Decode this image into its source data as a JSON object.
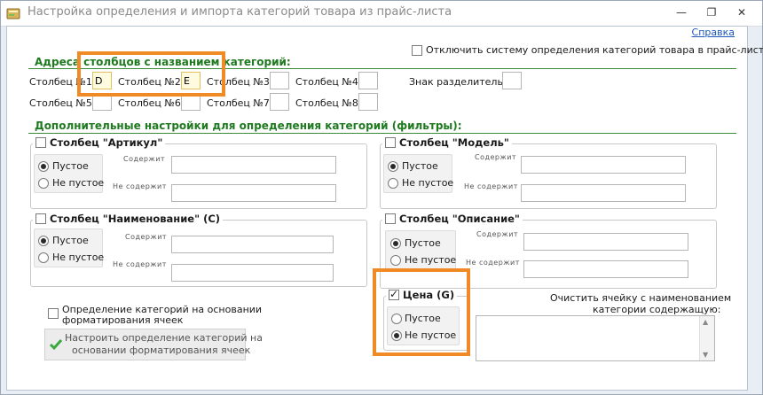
{
  "window": {
    "title": "Настройка определения и импорта категорий товара из прайс-листа",
    "help_link": "Справка"
  },
  "disable_system": {
    "label": "Отключить систему определения категорий товара в прайс-листе",
    "checked": false
  },
  "columns_section": {
    "title": "Адреса столбцов с названием категорий:",
    "col1_label": "Столбец №1:",
    "col1_value": "D",
    "col2_label": "Столбец №2:",
    "col2_value": "E",
    "col3_label": "Столбец №3:",
    "col3_value": "",
    "col4_label": "Столбец №4:",
    "col4_value": "",
    "col5_label": "Столбец №5:",
    "col5_value": "",
    "col6_label": "Столбец №6:",
    "col6_value": "",
    "col7_label": "Столбец №7:",
    "col7_value": "",
    "col8_label": "Столбец №8:",
    "col8_value": "",
    "separator_label": "Знак разделитель:",
    "separator_value": ""
  },
  "filters_section": {
    "title": "Дополнительные настройки для определения категорий (фильтры):",
    "empty_label": "Пустое",
    "not_empty_label": "Не пустое",
    "contains_label": "Содержит",
    "not_contains_label": "Не содержит",
    "article": {
      "title": "Столбец \"Артикул\"",
      "checked": false,
      "selected": "empty"
    },
    "model": {
      "title": "Столбец \"Модель\"",
      "checked": false,
      "selected": "empty"
    },
    "name": {
      "title": "Столбец \"Наименование\" (C)",
      "checked": false,
      "selected": "empty"
    },
    "description": {
      "title": "Столбец \"Описание\"",
      "checked": false,
      "selected": "empty"
    },
    "price": {
      "title": "Цена (G)",
      "checked": true,
      "selected": "not_empty"
    }
  },
  "formatting": {
    "checkbox_label_line1": "Определение категорий на основании",
    "checkbox_label_line2": "форматирования ячеек",
    "checked": false,
    "button_line1": "Настроить определение категорий на",
    "button_line2": "основании форматирования ячеек"
  },
  "clear_cell": {
    "label_line1": "Очистить ячейку с наименованием",
    "label_line2": "категории содержащую:"
  }
}
